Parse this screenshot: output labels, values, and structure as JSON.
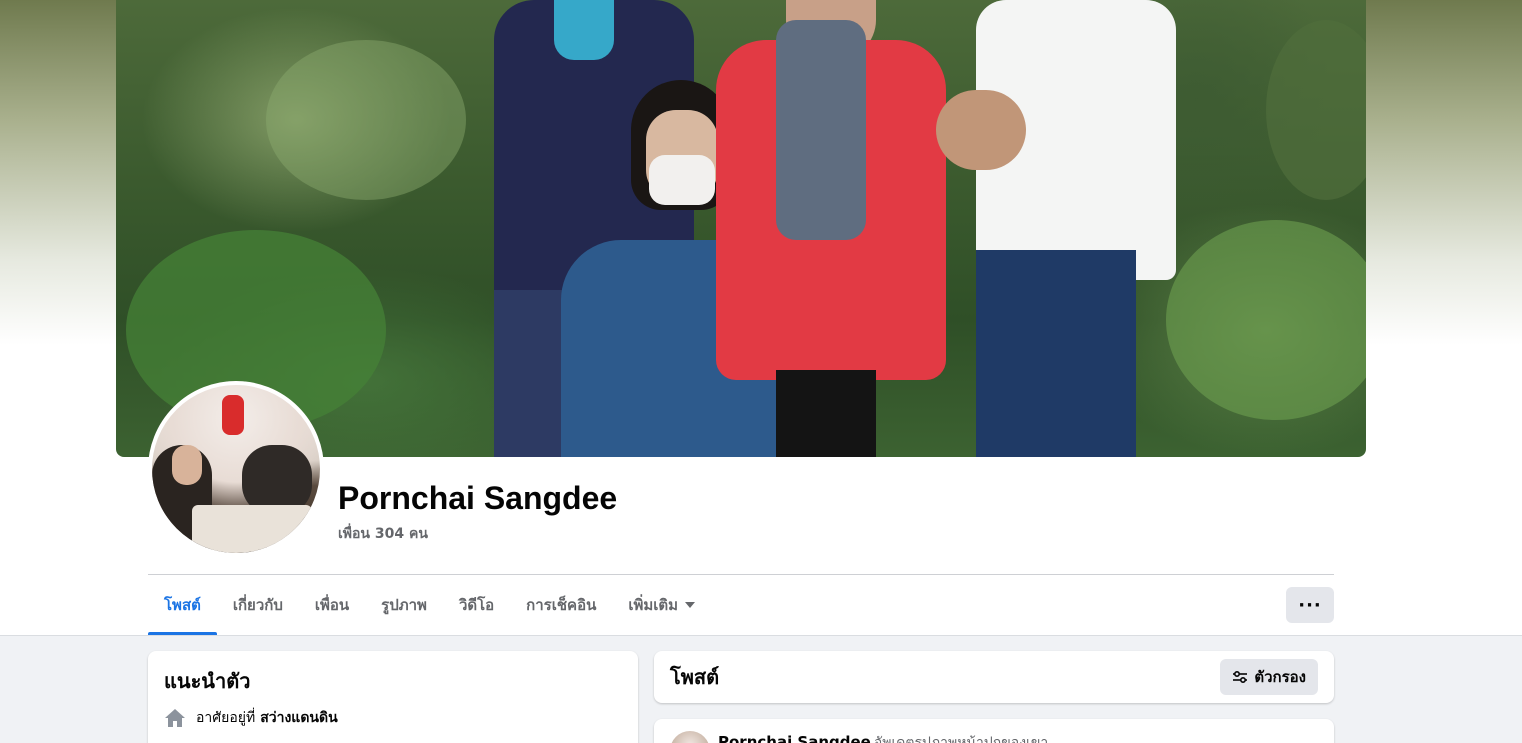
{
  "profile": {
    "name": "Pornchai Sangdee",
    "friends": "เพื่อน 304 คน"
  },
  "tabs": [
    {
      "label": "โพสต์",
      "active": true
    },
    {
      "label": "เกี่ยวกับ"
    },
    {
      "label": "เพื่อน"
    },
    {
      "label": "รูปภาพ"
    },
    {
      "label": "วิดีโอ"
    },
    {
      "label": "การเช็คอิน"
    },
    {
      "label": "เพิ่มเติม"
    }
  ],
  "more_button": "···",
  "intro": {
    "title": "แนะนำตัว",
    "lives_label": "อาศัยอยู่ที่",
    "lives_value": "สว่างแดนดิน"
  },
  "posts": {
    "title": "โพสต์",
    "filter_label": "ตัวกรอง"
  },
  "post": {
    "author": "Pornchai Sangdee",
    "action": "อัพเดตรูปภาพหน้าปกของเขา"
  },
  "colors": {
    "accent": "#1b74e4",
    "page_bg": "#f0f2f5",
    "secondary_text": "#65676b"
  }
}
